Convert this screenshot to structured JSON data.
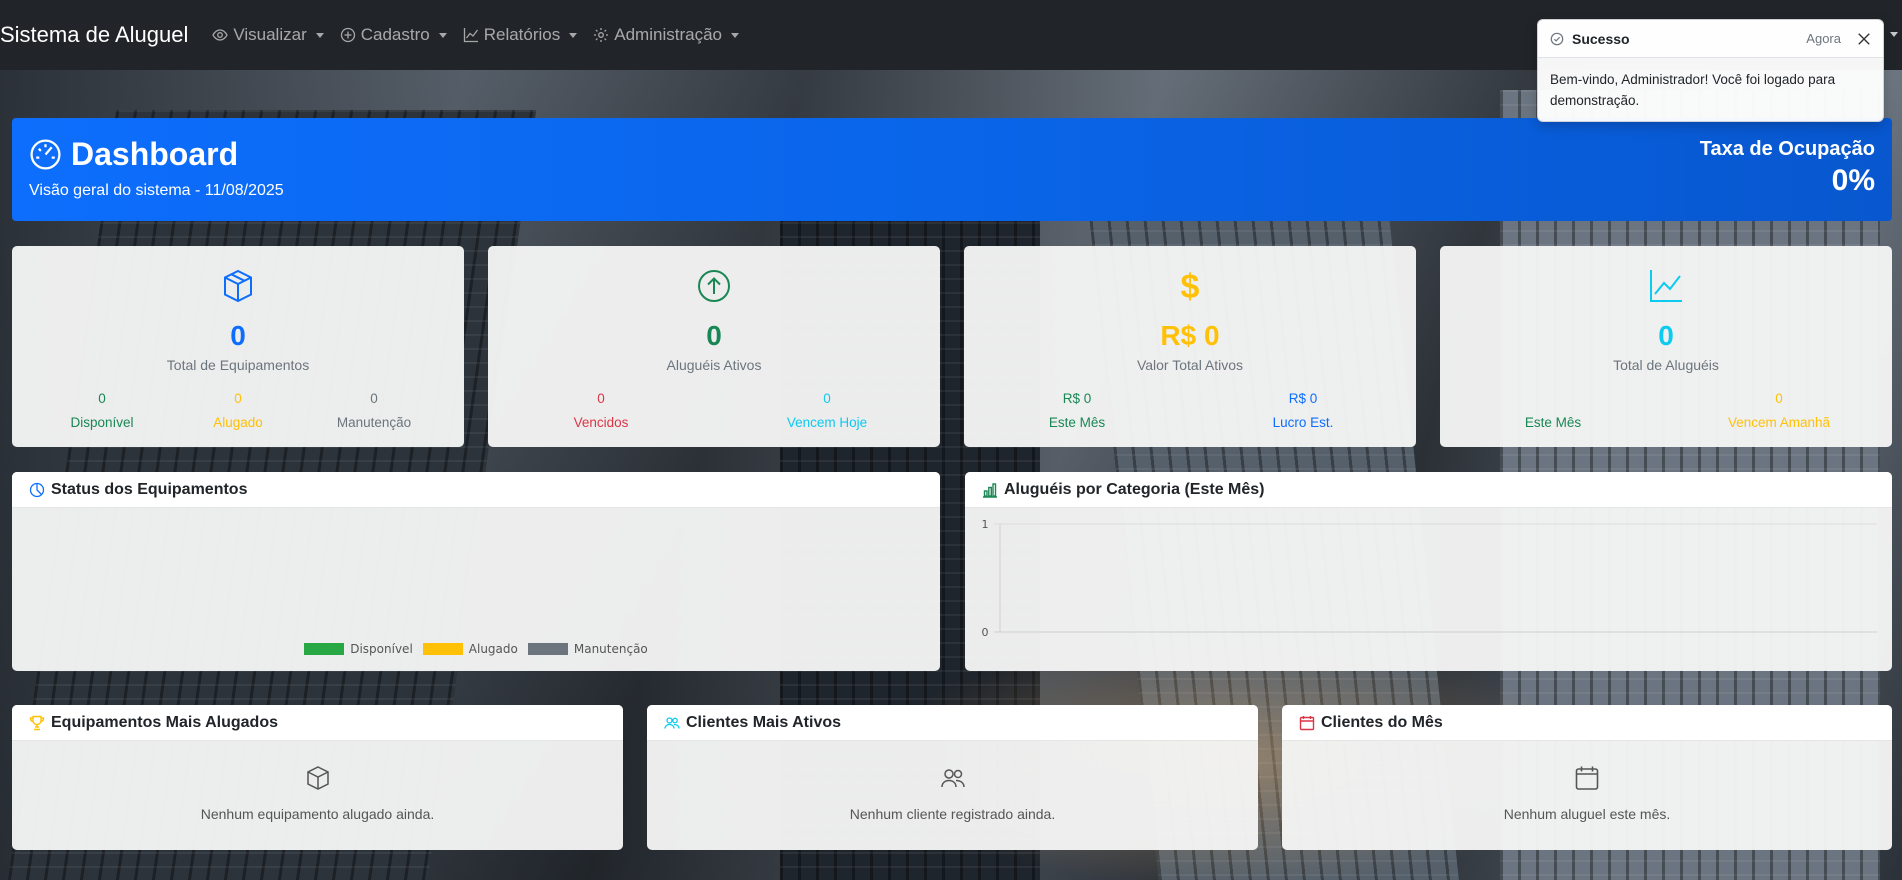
{
  "navbar": {
    "brand": "Sistema de Aluguel",
    "items": [
      {
        "label": "Visualizar",
        "icon": "eye-icon"
      },
      {
        "label": "Cadastro",
        "icon": "plus-circle-icon"
      },
      {
        "label": "Relatórios",
        "icon": "line-chart-icon"
      },
      {
        "label": "Administração",
        "icon": "gear-icon"
      }
    ]
  },
  "toast": {
    "title": "Sucesso",
    "time": "Agora",
    "message": "Bem-vindo, Administrador! Você foi logado para demonstração."
  },
  "hero": {
    "title": "Dashboard",
    "subtitle": "Visão geral do sistema - 11/08/2025",
    "kpi_label": "Taxa de Ocupação",
    "kpi_value": "0%"
  },
  "stats": {
    "equipamentos": {
      "value": "0",
      "label": "Total de Equipamentos",
      "sub": [
        {
          "value": "0",
          "label": "Disponível"
        },
        {
          "value": "0",
          "label": "Alugado"
        },
        {
          "value": "0",
          "label": "Manutenção"
        }
      ]
    },
    "alugueis_ativos": {
      "value": "0",
      "label": "Aluguéis Ativos",
      "sub": [
        {
          "value": "0",
          "label": "Vencidos"
        },
        {
          "value": "0",
          "label": "Vencem Hoje"
        }
      ]
    },
    "valor": {
      "value": "R$ 0",
      "label": "Valor Total Ativos",
      "sub": [
        {
          "value": "R$ 0",
          "label": "Este Mês"
        },
        {
          "value": "R$ 0",
          "label": "Lucro Est."
        }
      ]
    },
    "total_alugueis": {
      "value": "0",
      "label": "Total de Aluguéis",
      "sub": [
        {
          "value": "",
          "label": "Este Mês"
        },
        {
          "value": "0",
          "label": "Vencem Amanhã"
        }
      ]
    }
  },
  "colors": {
    "primary": "#0d6efd",
    "success": "#198754",
    "warning": "#ffc107",
    "danger": "#dc3545",
    "info": "#0dcaf0",
    "secondary": "#6c757d",
    "legend_green": "#28a745"
  },
  "charts": {
    "status": {
      "title": "Status dos Equipamentos",
      "legend": [
        "Disponível",
        "Alugado",
        "Manutenção"
      ]
    },
    "categoria": {
      "title": "Aluguéis por Categoria (Este Mês)"
    }
  },
  "chart_data": [
    {
      "type": "pie",
      "title": "",
      "categories": [
        "Disponível",
        "Alugado",
        "Manutenção"
      ],
      "values": [
        0,
        0,
        0
      ],
      "legend_position": "bottom"
    },
    {
      "type": "bar",
      "title": "",
      "categories": [],
      "values": [],
      "yticks": [
        "1",
        "0"
      ],
      "ylim": [
        0,
        1
      ],
      "grid": true
    }
  ],
  "bottom": {
    "mais_alugados": {
      "title": "Equipamentos Mais Alugados",
      "empty": "Nenhum equipamento alugado ainda."
    },
    "clientes_ativos": {
      "title": "Clientes Mais Ativos",
      "empty": "Nenhum cliente registrado ainda."
    },
    "clientes_mes": {
      "title": "Clientes do Mês",
      "empty": "Nenhum aluguel este mês."
    }
  }
}
